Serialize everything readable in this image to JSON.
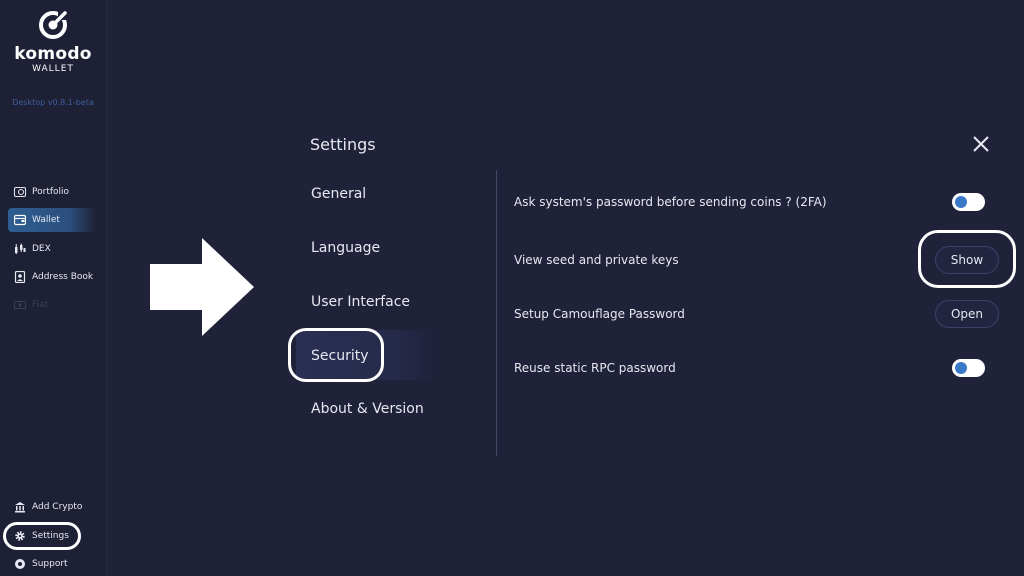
{
  "sidebar": {
    "brand": "komodo",
    "brand_sub": "WALLET",
    "version": "Desktop v0.8.1-beta",
    "items": [
      {
        "label": "Portfolio",
        "icon": "portfolio-icon"
      },
      {
        "label": "Wallet",
        "icon": "wallet-icon",
        "active": true
      },
      {
        "label": "DEX",
        "icon": "dex-icon"
      },
      {
        "label": "Address Book",
        "icon": "address-book-icon"
      },
      {
        "label": "Fiat",
        "icon": "fiat-icon",
        "disabled": true
      }
    ],
    "bottom_items": [
      {
        "label": "Add Crypto",
        "icon": "add-crypto-icon"
      },
      {
        "label": "Settings",
        "icon": "gear-icon"
      },
      {
        "label": "Support",
        "icon": "support-icon"
      }
    ]
  },
  "settings": {
    "title": "Settings",
    "menu": [
      "General",
      "Language",
      "User Interface",
      "Security",
      "About & Version"
    ],
    "selected": "Security",
    "rows": [
      {
        "label": "Ask system's password before sending coins ? (2FA)",
        "control": "toggle",
        "on": true
      },
      {
        "label": "View seed and private keys",
        "control": "button",
        "button_label": "Show"
      },
      {
        "label": "Setup Camouflage Password",
        "control": "button",
        "button_label": "Open"
      },
      {
        "label": "Reuse static RPC password",
        "control": "toggle",
        "on": true
      }
    ]
  },
  "colors": {
    "background": "#20223a",
    "sidebar": "#1e2036",
    "accent": "#3a78c8",
    "version_text": "#3c5e9a"
  }
}
